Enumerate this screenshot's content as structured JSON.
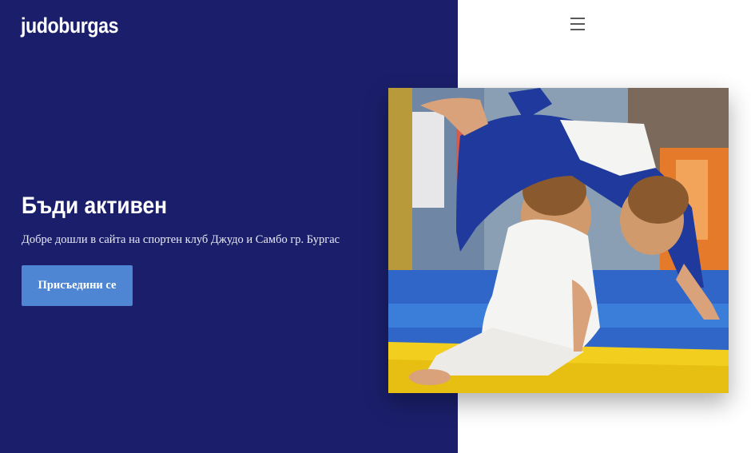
{
  "header": {
    "logo_text": "judoburgas",
    "menu_icon": "hamburger-menu-icon"
  },
  "hero": {
    "title": "Бъди активен",
    "subtitle": "Добре дошли в сайта на спортен клуб Джудо и Самбо гр. Бургас",
    "cta_label": "Присъедини се",
    "image_icon": "judo-throw-photo"
  },
  "colors": {
    "panel_background": "#1b1f6b",
    "page_background": "#ffffff",
    "button_background": "#4f86d3",
    "text_primary": "#ffffff"
  }
}
